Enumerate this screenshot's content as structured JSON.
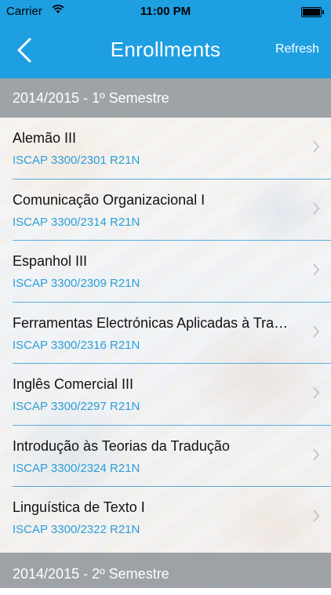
{
  "status_bar": {
    "carrier": "Carrier",
    "time": "11:00 PM"
  },
  "nav": {
    "title": "Enrollments",
    "refresh_label": "Refresh",
    "back_icon": "chevron-left-icon"
  },
  "sections": [
    {
      "header": "2014/2015 - 1º Semestre",
      "items": [
        {
          "title": "Alemão III",
          "code": "ISCAP 3300/2301 R21N"
        },
        {
          "title": "Comunicação Organizacional I",
          "code": "ISCAP 3300/2314 R21N"
        },
        {
          "title": "Espanhol III",
          "code": "ISCAP 3300/2309 R21N"
        },
        {
          "title": "Ferramentas Electrónicas Aplicadas à Tra…",
          "code": "ISCAP 3300/2316 R21N"
        },
        {
          "title": "Inglês Comercial III",
          "code": "ISCAP 3300/2297 R21N"
        },
        {
          "title": "Introdução às Teorias da Tradução",
          "code": "ISCAP 3300/2324 R21N"
        },
        {
          "title": "Linguística de Texto I",
          "code": "ISCAP 3300/2322 R21N"
        }
      ]
    },
    {
      "header": "2014/2015 - 2º Semestre",
      "items": []
    }
  ],
  "colors": {
    "accent": "#1e9fe1",
    "section_header": "#969ba0",
    "code_text": "#2b9ed8"
  }
}
